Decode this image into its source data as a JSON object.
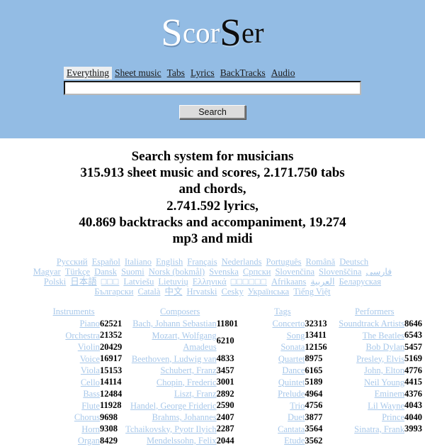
{
  "colors": {
    "header_bg": "#93bce4",
    "link": "#a8c8ea",
    "text": "#000000",
    "active_tab_bg": "#eceff1",
    "button_bg": "#dcdcdc"
  },
  "logo": {
    "part1": "cor",
    "bigS1": "S",
    "bigS2": "S",
    "part2": "er"
  },
  "search": {
    "tabs": [
      {
        "label": "Everything",
        "active": true
      },
      {
        "label": "Sheet music",
        "active": false
      },
      {
        "label": "Tabs",
        "active": false
      },
      {
        "label": "Lyrics",
        "active": false
      },
      {
        "label": "BackTracks",
        "active": false
      },
      {
        "label": "Audio",
        "active": false
      }
    ],
    "query_value": "",
    "placeholder": "",
    "button_label": "Search"
  },
  "tagline": {
    "lines": [
      "Search system for musicians",
      "315.913 sheet music and scores, 2.171.750 tabs",
      "and chords,",
      "2.741.592 lyrics,",
      "40.869 backtracks and accompaniment, 19.274",
      "mp3 and midi"
    ]
  },
  "languages": {
    "rows": [
      [
        "Русский",
        "Español",
        "Italiano",
        "English",
        "Français",
        "Nederlands",
        "Português",
        "Română",
        "Deutsch"
      ],
      [
        "Magyar",
        "Türkçe",
        "Dansk",
        "Suomi",
        "Norsk (bokmål)",
        "Svenska",
        "Српски",
        "Slovenčina",
        "Slovenščina",
        "فارسی"
      ],
      [
        "Polski",
        "日本語",
        "□□□",
        "Latviešu",
        "Lietuvių",
        "Ελληνικά",
        "□□□□□□",
        "Afrikaans",
        "العربية",
        "Беларуская"
      ],
      [
        "Български",
        "Català",
        "中文",
        "Hrvatski",
        "Cesky",
        "Українська",
        "Tiếng Việt"
      ]
    ]
  },
  "columns": [
    {
      "title": "Instruments",
      "rows": [
        {
          "name": "Piano",
          "count": "62521"
        },
        {
          "name": "Orchestra",
          "count": "21352"
        },
        {
          "name": "Violin",
          "count": "20429"
        },
        {
          "name": "Voice",
          "count": "16917"
        },
        {
          "name": "Viola",
          "count": "15153"
        },
        {
          "name": "Cello",
          "count": "14114"
        },
        {
          "name": "Bass",
          "count": "12484"
        },
        {
          "name": "Flute",
          "count": "11928"
        },
        {
          "name": "Chorus",
          "count": "9698"
        },
        {
          "name": "Horn",
          "count": "9308"
        },
        {
          "name": "Organ",
          "count": "8429"
        }
      ]
    },
    {
      "title": "Composers",
      "rows": [
        {
          "name": "Bach, Johann Sebastian",
          "count": "11801"
        },
        {
          "name": "Mozart, Wolfgang Amadeus",
          "count": "6210"
        },
        {
          "name": "Beethoven, Ludwig van",
          "count": "4833"
        },
        {
          "name": "Schubert, Franz",
          "count": "3457"
        },
        {
          "name": "Chopin, Frederic",
          "count": "3001"
        },
        {
          "name": "Liszt, Franz",
          "count": "2892"
        },
        {
          "name": "Handel, George Frideric",
          "count": "2590"
        },
        {
          "name": "Brahms, Johannes",
          "count": "2407"
        },
        {
          "name": "Tchaikovsky, Pyotr Ilyich",
          "count": "2287"
        },
        {
          "name": "Mendelssohn, Felix",
          "count": "2044"
        }
      ]
    },
    {
      "title": "Tags",
      "rows": [
        {
          "name": "Concerto",
          "count": "32313"
        },
        {
          "name": "Song",
          "count": "13411"
        },
        {
          "name": "Sonata",
          "count": "12156"
        },
        {
          "name": "Quartet",
          "count": "8975"
        },
        {
          "name": "Dance",
          "count": "6165"
        },
        {
          "name": "Quintet",
          "count": "5189"
        },
        {
          "name": "Prelude",
          "count": "4964"
        },
        {
          "name": "Trio",
          "count": "4756"
        },
        {
          "name": "Duet",
          "count": "3877"
        },
        {
          "name": "Cantata",
          "count": "3564"
        },
        {
          "name": "Etude",
          "count": "3562"
        }
      ]
    },
    {
      "title": "Performers",
      "rows": [
        {
          "name": "Soundtrack Artists",
          "count": "8646"
        },
        {
          "name": "The Beatles",
          "count": "6543"
        },
        {
          "name": "Bob Dylan",
          "count": "5457"
        },
        {
          "name": "Presley, Elvis",
          "count": "5169"
        },
        {
          "name": "John, Elton",
          "count": "4776"
        },
        {
          "name": "Neil Young",
          "count": "4415"
        },
        {
          "name": "Eminem",
          "count": "4376"
        },
        {
          "name": "Lil Wayne",
          "count": "4043"
        },
        {
          "name": "Prince",
          "count": "4040"
        },
        {
          "name": "Sinatra, Frank",
          "count": "3993"
        }
      ]
    }
  ]
}
